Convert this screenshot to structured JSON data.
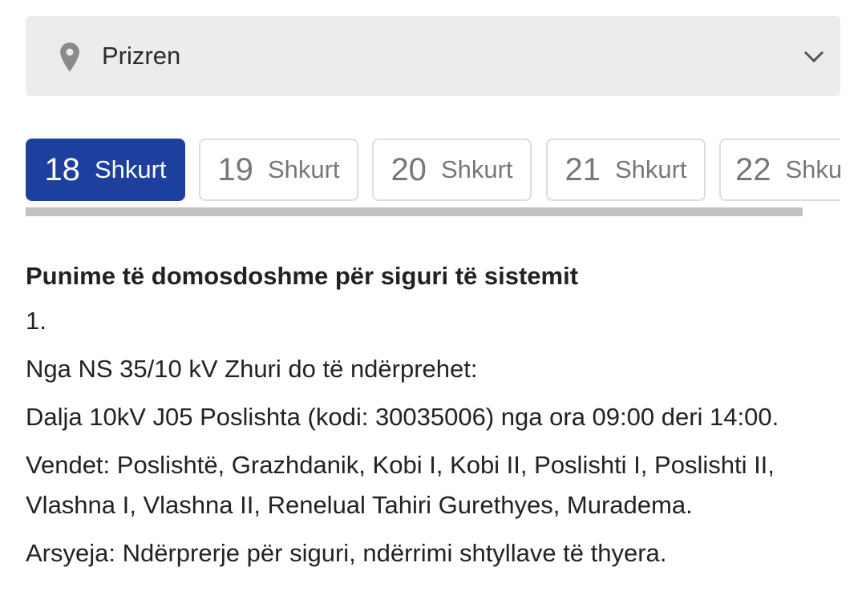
{
  "location": {
    "selected": "Prizren"
  },
  "date_tabs": [
    {
      "day": "18",
      "month": "Shkurt",
      "active": true
    },
    {
      "day": "19",
      "month": "Shkurt",
      "active": false
    },
    {
      "day": "20",
      "month": "Shkurt",
      "active": false
    },
    {
      "day": "21",
      "month": "Shkurt",
      "active": false
    },
    {
      "day": "22",
      "month": "Shkurt",
      "active": false
    }
  ],
  "notice": {
    "title": "Punime të domosdoshme për siguri të sistemit",
    "number": "1.",
    "source": "Nga NS 35/10 kV Zhuri do të ndërprehet:",
    "feeder": "Dalja 10kV J05 Poslishta (kodi: 30035006) nga ora 09:00 deri 14:00.",
    "places": "Vendet: Poslishtë, Grazhdanik, Kobi I, Kobi II, Poslishti I, Poslishti II, Vlashna I, Vlashna II, Renelual Tahiri Gurethyes, Muradema.",
    "reason": "Arsyeja: Ndërprerje për siguri, ndërrimi shtyllave të thyera."
  },
  "colors": {
    "accent": "#1d3f9e",
    "select_bg": "#ececec",
    "tab_border": "#dedede",
    "scrollbar": "#c1c1c1"
  },
  "icons": {
    "location": "map-pin-icon",
    "dropdown": "chevron-down-icon"
  }
}
